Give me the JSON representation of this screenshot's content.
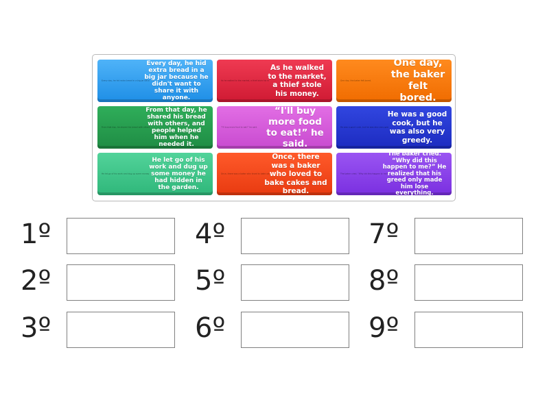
{
  "tiles": [
    {
      "text": "Every day, he hid extra bread in a big jar because he didn't want to share it with anyone.",
      "mini": "Every day, he hid extra bread in a big jar because he didn't want to share it with anyone.",
      "color": "#2a9ef0"
    },
    {
      "text": "As he walked to the market, a thief stole his money.",
      "mini": "As he walked to the market, a thief stole his money.",
      "color": "#de2a43"
    },
    {
      "text": "One day, the baker felt bored.",
      "mini": "One day, the baker felt bored.",
      "color": "#f57a0c"
    },
    {
      "text": "From that day, he shared his bread with others, and people helped him when he needed it.",
      "mini": "From that day, he shared his bread with others, and people helped him when he needed it.",
      "color": "#26994d"
    },
    {
      "text": "“I'll buy more food to eat!” he said.",
      "mini": "“I'll buy more food to eat!” he said.",
      "color": "#d45ada"
    },
    {
      "text": "He was a good cook, but he was also very greedy.",
      "mini": "He was a good cook, but he was also very greedy.",
      "color": "#2637d2"
    },
    {
      "text": "He let go of his work and dug up some money he had hidden in the garden.",
      "mini": "He let go of his work and dug up some money he had hidden in the garden.",
      "color": "#3fc58a"
    },
    {
      "text": "Once, there was a baker who loved to bake cakes and bread.",
      "mini": "Once, there was a baker who loved to bake cakes and bread.",
      "color": "#f2481c"
    },
    {
      "text": "The baker cried. “Why did this happen to me?” He realized that his greed only made him lose everything.",
      "mini": "The baker cried. “Why did this happen to me?” He realized that his greed only made him lose everything.",
      "color": "#8a42ea"
    }
  ],
  "slots": [
    "1º",
    "2º",
    "3º",
    "4º",
    "5º",
    "6º",
    "7º",
    "8º",
    "9º"
  ]
}
